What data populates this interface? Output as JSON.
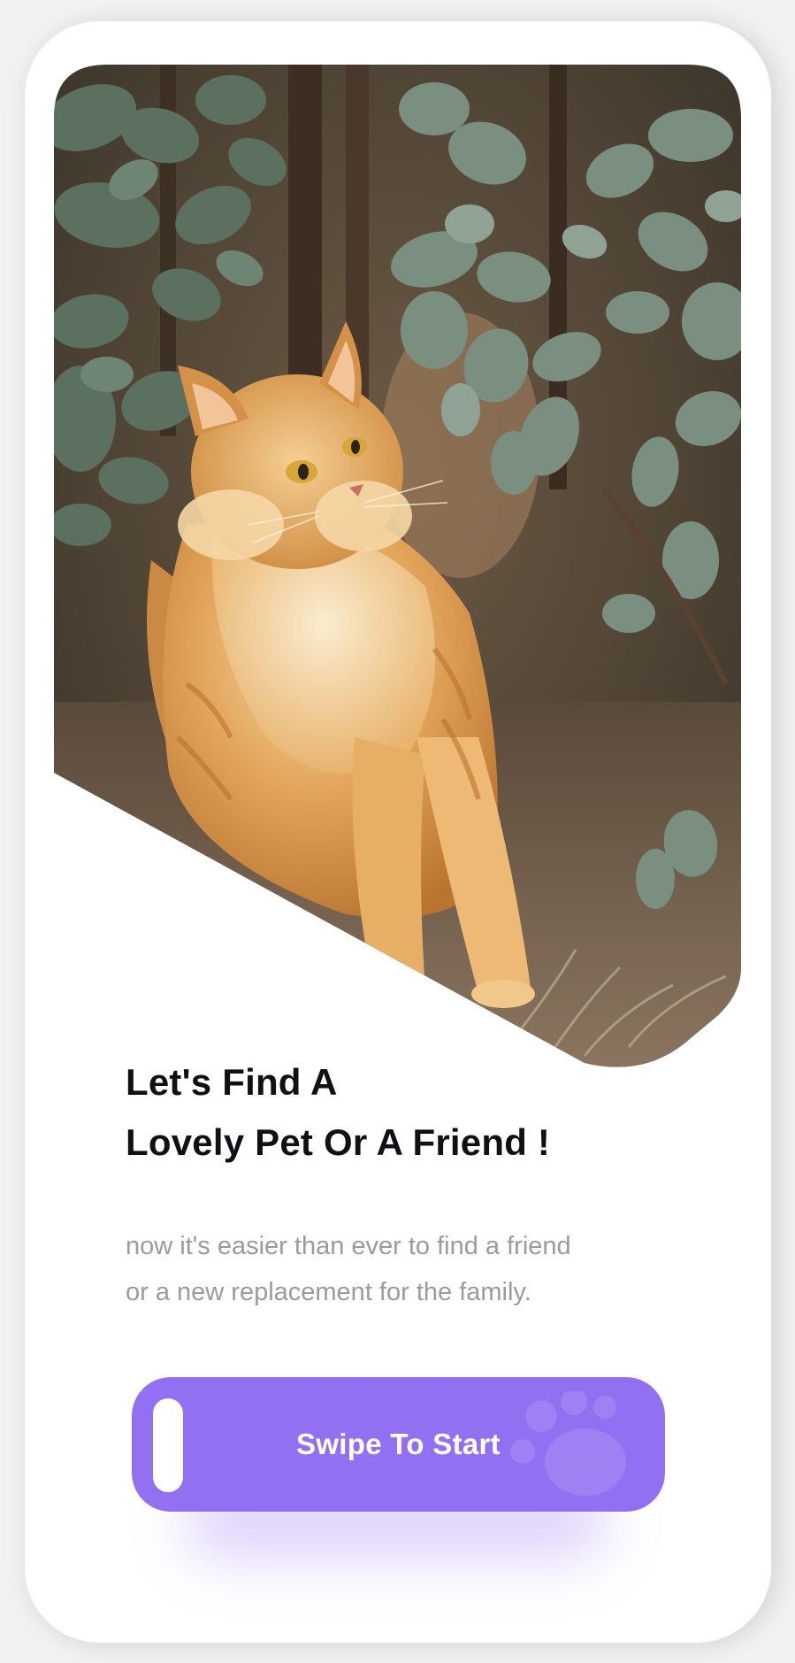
{
  "onboarding": {
    "headline_line1": "Let's Find A",
    "headline_line2": "Lovely Pet Or A Friend !",
    "subtext_line1": "now it's easier than ever to find a friend",
    "subtext_line2": "or a new replacement for the family.",
    "cta_label": "Swipe To Start"
  },
  "colors": {
    "accent": "#9370f2",
    "background": "#ffffff",
    "headline": "#101015",
    "subtext": "#9a9aa2"
  },
  "icons": {
    "paw": "paw-icon",
    "swipe_handle": "swipe-handle"
  }
}
